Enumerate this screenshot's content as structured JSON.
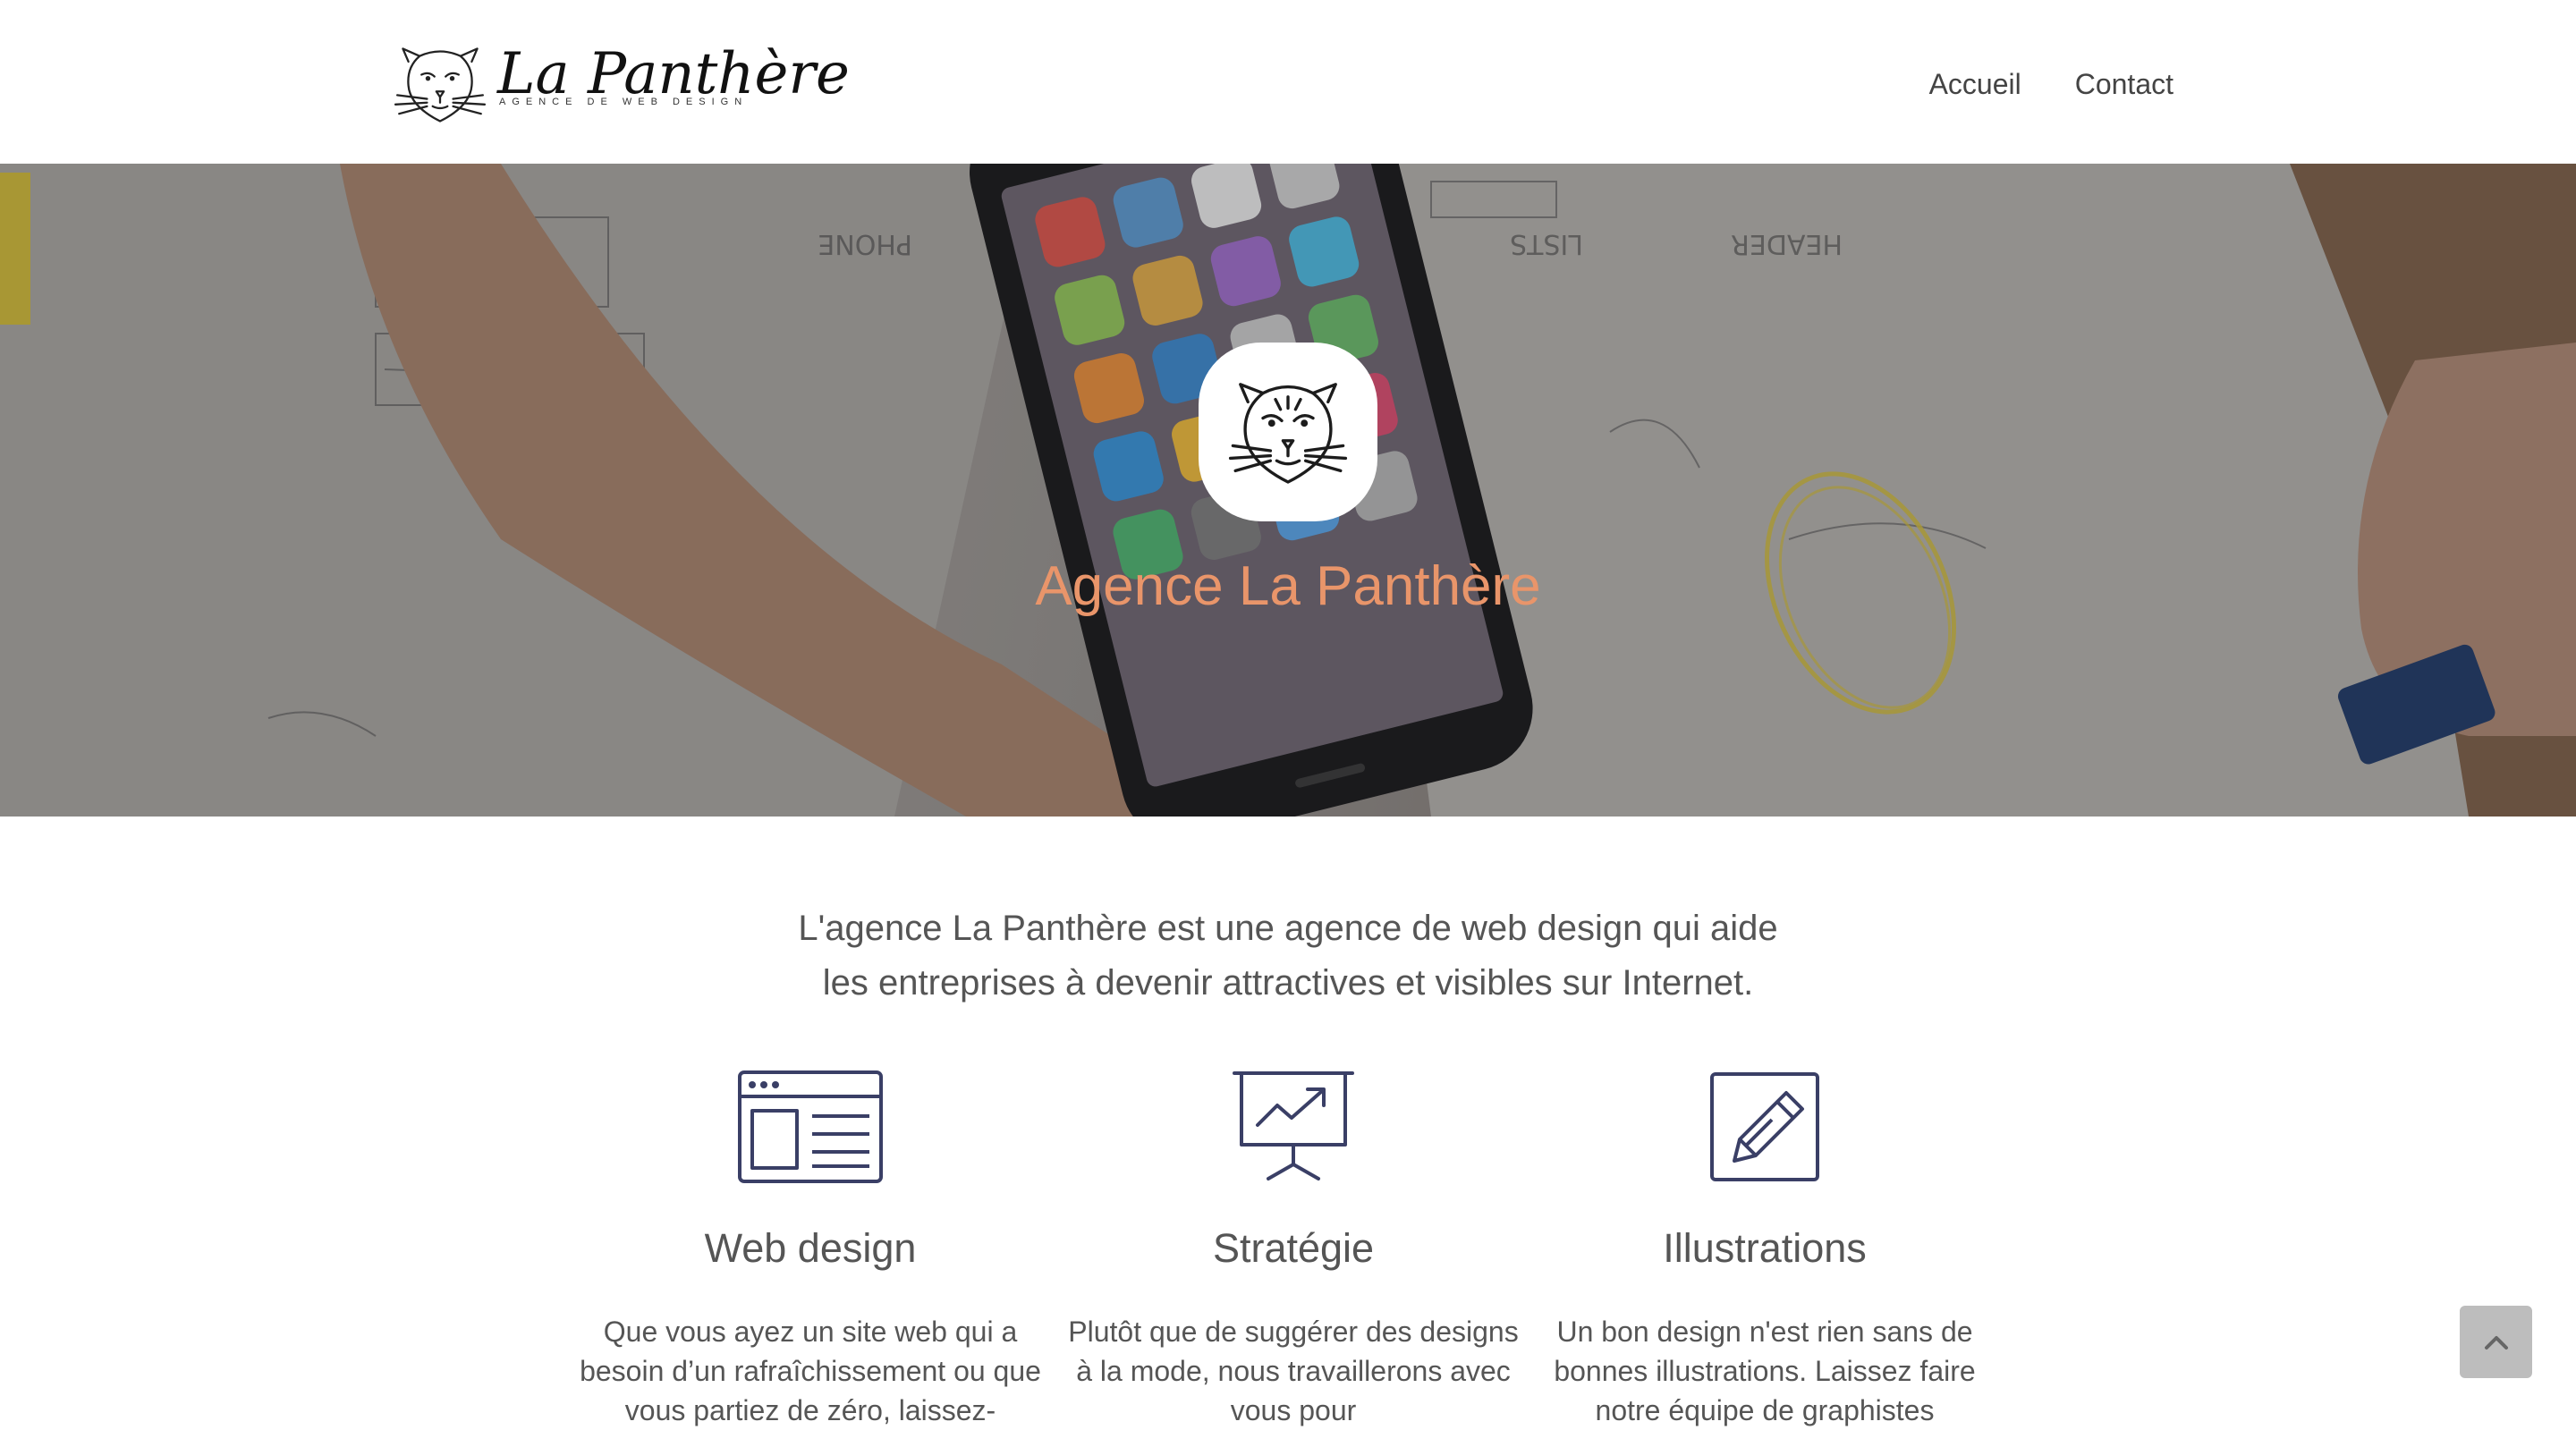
{
  "header": {
    "logo_name": "La Panthère",
    "logo_tagline": "AGENCE DE WEB DESIGN",
    "nav": [
      {
        "label": "Accueil"
      },
      {
        "label": "Contact"
      }
    ]
  },
  "hero": {
    "title": "Agence La Panthère"
  },
  "intro": {
    "line1": "L'agence La Panthère est une agence de web design qui aide",
    "line2": "les entreprises à devenir attractives et visibles sur Internet."
  },
  "services": [
    {
      "title": "Web design",
      "icon": "browser-layout-icon",
      "text": "Que vous ayez un site web qui a besoin d’un rafraîchissement ou que vous partiez de zéro, laissez-"
    },
    {
      "title": "Stratégie",
      "icon": "presentation-chart-icon",
      "text": "Plutôt que de suggérer des designs à la mode, nous travaillerons avec vous pour"
    },
    {
      "title": "Illustrations",
      "icon": "pencil-square-icon",
      "text": "Un bon design n'est rien sans de bonnes illustrations. Laissez faire notre équipe de graphistes"
    }
  ],
  "colors": {
    "accent": "#e9956a",
    "icon_stroke": "#3a3f66",
    "text": "#555555"
  },
  "back_to_top_icon": "chevron-up-icon"
}
